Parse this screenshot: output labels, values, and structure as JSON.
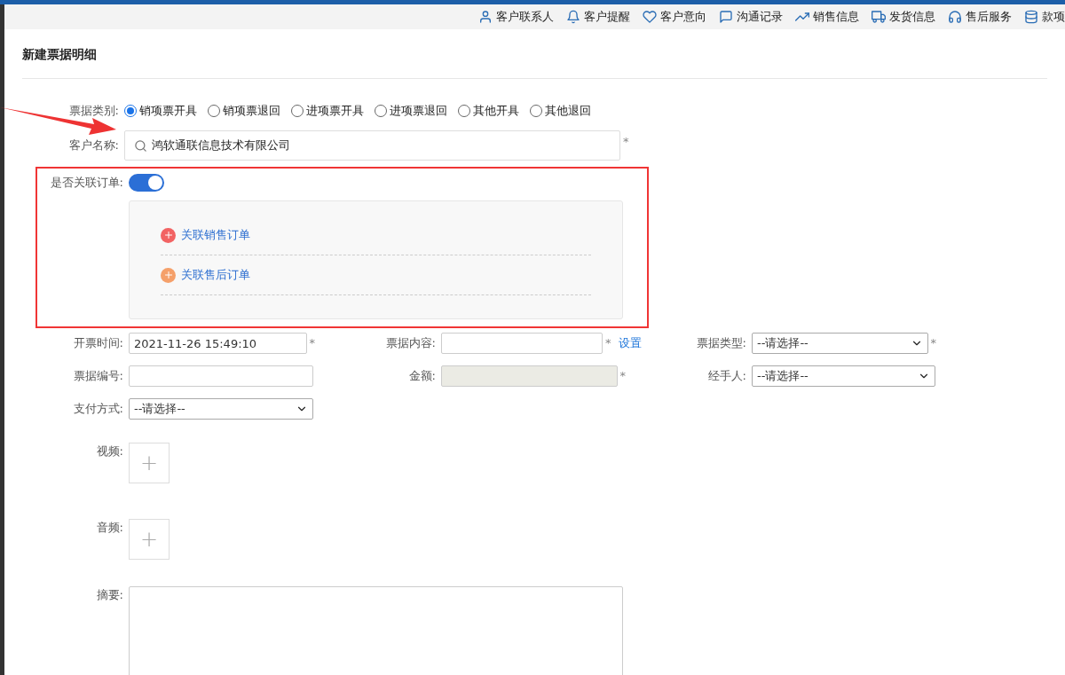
{
  "toolbar": [
    {
      "kind": "contact",
      "label": "客户联系人"
    },
    {
      "kind": "bell",
      "label": "客户提醒"
    },
    {
      "kind": "intent",
      "label": "客户意向"
    },
    {
      "kind": "chat",
      "label": "沟通记录"
    },
    {
      "kind": "chart",
      "label": "销售信息"
    },
    {
      "kind": "truck",
      "label": "发货信息"
    },
    {
      "kind": "headset",
      "label": "售后服务"
    },
    {
      "kind": "coins",
      "label": "款项"
    }
  ],
  "title": "新建票据明细",
  "category": {
    "label": "票据类别:",
    "options": [
      {
        "label": "销项票开具",
        "selected": true
      },
      {
        "label": "销项票退回",
        "selected": false
      },
      {
        "label": "进项票开具",
        "selected": false
      },
      {
        "label": "进项票退回",
        "selected": false
      },
      {
        "label": "其他开具",
        "selected": false
      },
      {
        "label": "其他退回",
        "selected": false
      }
    ]
  },
  "customer": {
    "label": "客户名称:",
    "value": "鸿软通联信息技术有限公司",
    "required": "*"
  },
  "link_order": {
    "label": "是否关联订单:",
    "on": true,
    "actions": [
      {
        "label": "关联销售订单",
        "color": "#f26363"
      },
      {
        "label": "关联售后订单",
        "color": "#f5a06a"
      }
    ]
  },
  "fields": [
    {
      "kind": "input",
      "label": "开票时间:",
      "value": "2021-11-26 15:49:10",
      "required": "*"
    },
    {
      "kind": "input",
      "label": "票据内容:",
      "required": "*",
      "link": "设置"
    },
    {
      "kind": "select",
      "label": "票据类型:",
      "value": "--请选择--",
      "required": "*"
    },
    {
      "kind": "input",
      "label": "票据编号:"
    },
    {
      "kind": "input",
      "label": "金额:",
      "disabled": true,
      "required": "*"
    },
    {
      "kind": "select",
      "label": "经手人:",
      "value": "--请选择--"
    },
    {
      "kind": "select",
      "label": "支付方式:",
      "value": "--请选择--"
    }
  ],
  "uploads": [
    {
      "label": "视频:",
      "plus": "+"
    },
    {
      "label": "音频:",
      "plus": "+"
    }
  ],
  "summary": {
    "label": "摘要:"
  }
}
